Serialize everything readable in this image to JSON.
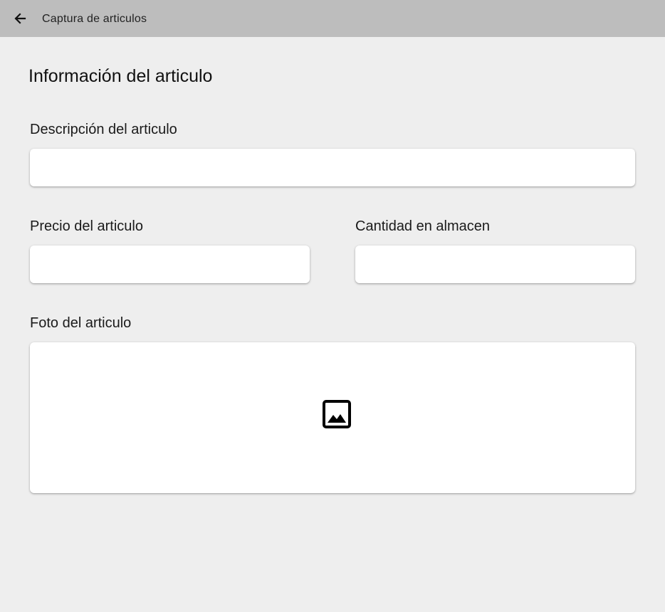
{
  "appbar": {
    "title": "Captura de articulos",
    "back_icon": "arrow-left-icon"
  },
  "form": {
    "section_title": "Información del articulo",
    "description": {
      "label": "Descripción del articulo",
      "value": "",
      "placeholder": ""
    },
    "price": {
      "label": "Precio del articulo",
      "value": "",
      "placeholder": ""
    },
    "stock": {
      "label": "Cantidad en almacen",
      "value": "",
      "placeholder": ""
    },
    "photo": {
      "label": "Foto del articulo",
      "icon": "image-icon"
    }
  }
}
